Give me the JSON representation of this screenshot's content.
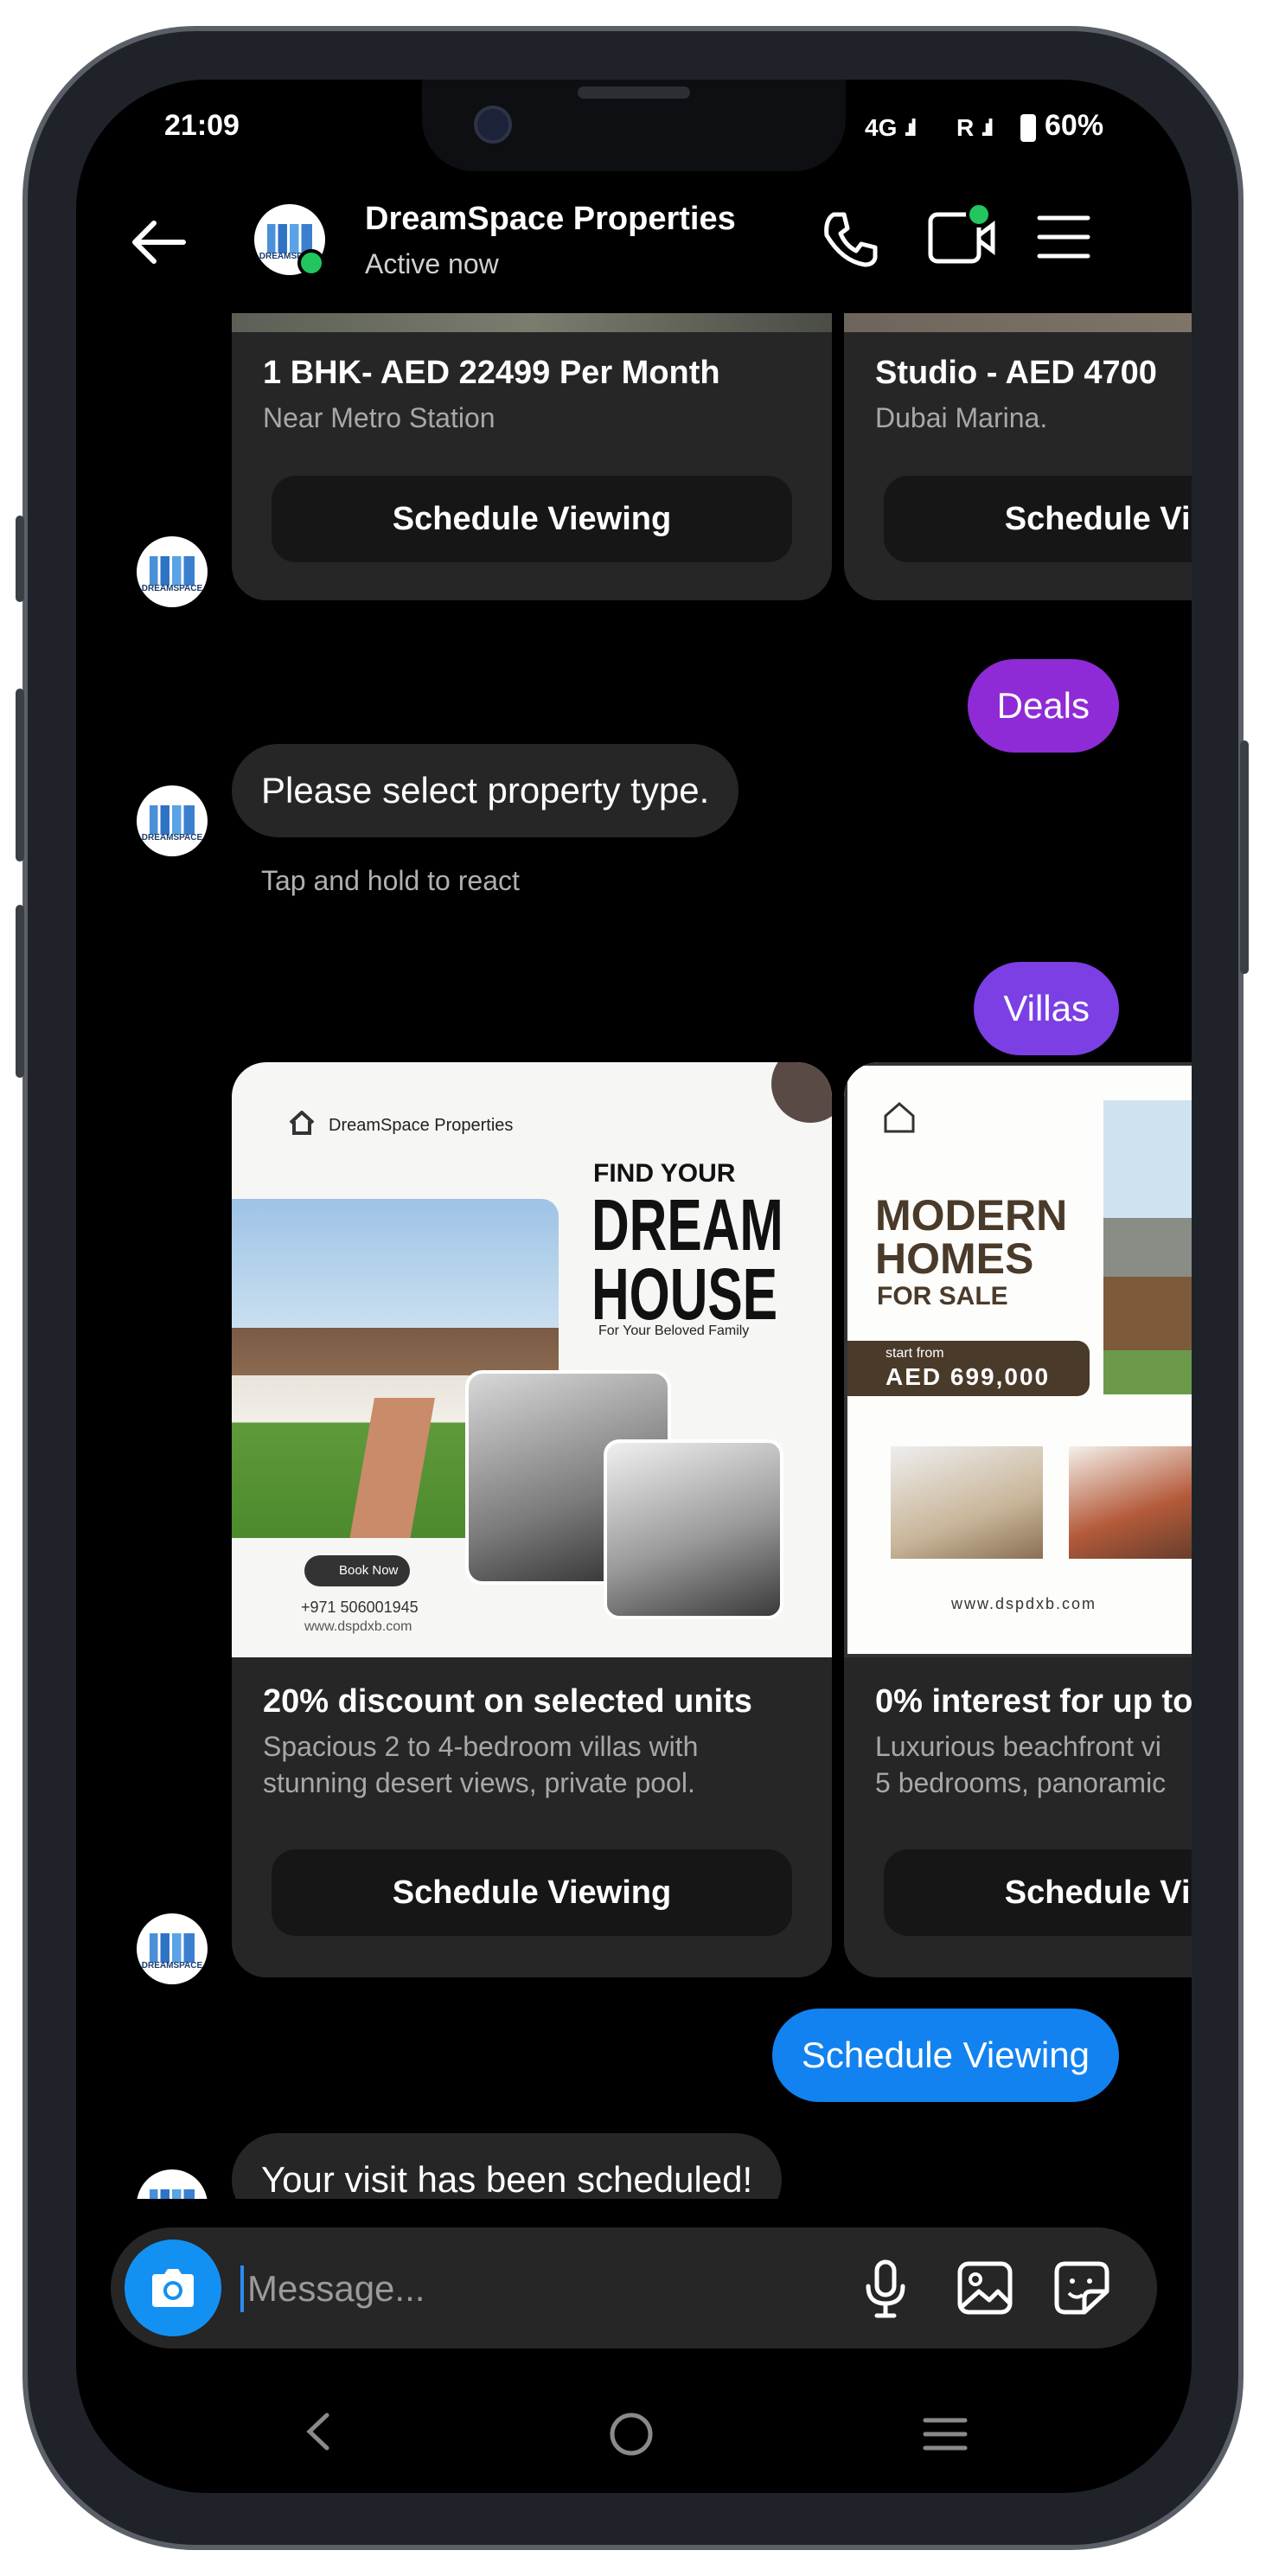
{
  "status_bar": {
    "time": "21:09",
    "network": "4G",
    "roaming": "R",
    "battery": "60%"
  },
  "header": {
    "name": "DreamSpace Properties",
    "status": "Active now"
  },
  "avatar_text": "DREAMSPACE",
  "top_cards": [
    {
      "title": "1 BHK- AED 22499 Per Month",
      "subtitle": "Near Metro Station",
      "button": "Schedule Viewing"
    },
    {
      "title": "Studio - AED 4700",
      "subtitle": "Dubai Marina.",
      "button": "Schedule Viewing"
    }
  ],
  "messages": {
    "deals": "Deals",
    "select_type": "Please select property type.",
    "tap_hint": "Tap and hold to react",
    "villas": "Villas",
    "schedule_viewing": "Schedule Viewing",
    "scheduled": "Your visit has been scheduled!"
  },
  "villa_cards": [
    {
      "poster": {
        "brand": "DreamSpace Properties",
        "line1": "FIND YOUR",
        "line2": "DREAM",
        "line3": "HOUSE",
        "tagline": "For Your Beloved Family",
        "book": "Book Now",
        "phone": "+971 506001945",
        "web": "www.dspdxb.com"
      },
      "title": "20% discount on selected units",
      "subtitle_line1": "Spacious 2 to 4-bedroom villas with",
      "subtitle_line2": "stunning desert views, private pool.",
      "button": "Schedule Viewing"
    },
    {
      "poster": {
        "line1": "MODERN",
        "line2": "HOMES",
        "line3": "FOR SALE",
        "start": "start from",
        "price": "AED 699,000",
        "web": "www.dspdxb.com"
      },
      "title": "0% interest for up to",
      "subtitle_line1": "Luxurious beachfront vi",
      "subtitle_line2": "5 bedrooms, panoramic",
      "button": "Schedule Viewing"
    }
  ],
  "composer": {
    "placeholder": "Message..."
  },
  "colors": {
    "purple": "#8e2bd6",
    "violet": "#7b3fe4",
    "blue": "#1282f0",
    "online": "#22c55e"
  }
}
